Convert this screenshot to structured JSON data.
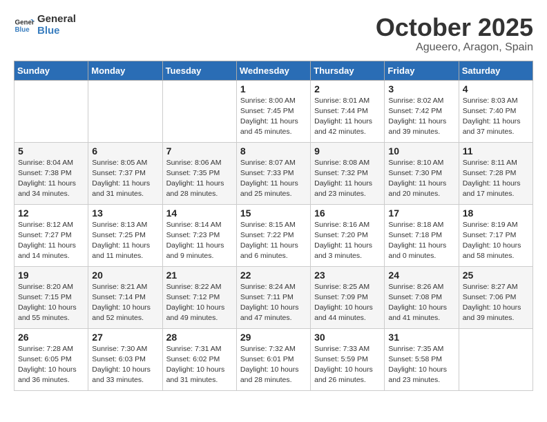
{
  "header": {
    "logo_line1": "General",
    "logo_line2": "Blue",
    "title": "October 2025",
    "subtitle": "Agueero, Aragon, Spain"
  },
  "weekdays": [
    "Sunday",
    "Monday",
    "Tuesday",
    "Wednesday",
    "Thursday",
    "Friday",
    "Saturday"
  ],
  "weeks": [
    [
      {
        "day": "",
        "detail": ""
      },
      {
        "day": "",
        "detail": ""
      },
      {
        "day": "",
        "detail": ""
      },
      {
        "day": "1",
        "detail": "Sunrise: 8:00 AM\nSunset: 7:45 PM\nDaylight: 11 hours\nand 45 minutes."
      },
      {
        "day": "2",
        "detail": "Sunrise: 8:01 AM\nSunset: 7:44 PM\nDaylight: 11 hours\nand 42 minutes."
      },
      {
        "day": "3",
        "detail": "Sunrise: 8:02 AM\nSunset: 7:42 PM\nDaylight: 11 hours\nand 39 minutes."
      },
      {
        "day": "4",
        "detail": "Sunrise: 8:03 AM\nSunset: 7:40 PM\nDaylight: 11 hours\nand 37 minutes."
      }
    ],
    [
      {
        "day": "5",
        "detail": "Sunrise: 8:04 AM\nSunset: 7:38 PM\nDaylight: 11 hours\nand 34 minutes."
      },
      {
        "day": "6",
        "detail": "Sunrise: 8:05 AM\nSunset: 7:37 PM\nDaylight: 11 hours\nand 31 minutes."
      },
      {
        "day": "7",
        "detail": "Sunrise: 8:06 AM\nSunset: 7:35 PM\nDaylight: 11 hours\nand 28 minutes."
      },
      {
        "day": "8",
        "detail": "Sunrise: 8:07 AM\nSunset: 7:33 PM\nDaylight: 11 hours\nand 25 minutes."
      },
      {
        "day": "9",
        "detail": "Sunrise: 8:08 AM\nSunset: 7:32 PM\nDaylight: 11 hours\nand 23 minutes."
      },
      {
        "day": "10",
        "detail": "Sunrise: 8:10 AM\nSunset: 7:30 PM\nDaylight: 11 hours\nand 20 minutes."
      },
      {
        "day": "11",
        "detail": "Sunrise: 8:11 AM\nSunset: 7:28 PM\nDaylight: 11 hours\nand 17 minutes."
      }
    ],
    [
      {
        "day": "12",
        "detail": "Sunrise: 8:12 AM\nSunset: 7:27 PM\nDaylight: 11 hours\nand 14 minutes."
      },
      {
        "day": "13",
        "detail": "Sunrise: 8:13 AM\nSunset: 7:25 PM\nDaylight: 11 hours\nand 11 minutes."
      },
      {
        "day": "14",
        "detail": "Sunrise: 8:14 AM\nSunset: 7:23 PM\nDaylight: 11 hours\nand 9 minutes."
      },
      {
        "day": "15",
        "detail": "Sunrise: 8:15 AM\nSunset: 7:22 PM\nDaylight: 11 hours\nand 6 minutes."
      },
      {
        "day": "16",
        "detail": "Sunrise: 8:16 AM\nSunset: 7:20 PM\nDaylight: 11 hours\nand 3 minutes."
      },
      {
        "day": "17",
        "detail": "Sunrise: 8:18 AM\nSunset: 7:18 PM\nDaylight: 11 hours\nand 0 minutes."
      },
      {
        "day": "18",
        "detail": "Sunrise: 8:19 AM\nSunset: 7:17 PM\nDaylight: 10 hours\nand 58 minutes."
      }
    ],
    [
      {
        "day": "19",
        "detail": "Sunrise: 8:20 AM\nSunset: 7:15 PM\nDaylight: 10 hours\nand 55 minutes."
      },
      {
        "day": "20",
        "detail": "Sunrise: 8:21 AM\nSunset: 7:14 PM\nDaylight: 10 hours\nand 52 minutes."
      },
      {
        "day": "21",
        "detail": "Sunrise: 8:22 AM\nSunset: 7:12 PM\nDaylight: 10 hours\nand 49 minutes."
      },
      {
        "day": "22",
        "detail": "Sunrise: 8:24 AM\nSunset: 7:11 PM\nDaylight: 10 hours\nand 47 minutes."
      },
      {
        "day": "23",
        "detail": "Sunrise: 8:25 AM\nSunset: 7:09 PM\nDaylight: 10 hours\nand 44 minutes."
      },
      {
        "day": "24",
        "detail": "Sunrise: 8:26 AM\nSunset: 7:08 PM\nDaylight: 10 hours\nand 41 minutes."
      },
      {
        "day": "25",
        "detail": "Sunrise: 8:27 AM\nSunset: 7:06 PM\nDaylight: 10 hours\nand 39 minutes."
      }
    ],
    [
      {
        "day": "26",
        "detail": "Sunrise: 7:28 AM\nSunset: 6:05 PM\nDaylight: 10 hours\nand 36 minutes."
      },
      {
        "day": "27",
        "detail": "Sunrise: 7:30 AM\nSunset: 6:03 PM\nDaylight: 10 hours\nand 33 minutes."
      },
      {
        "day": "28",
        "detail": "Sunrise: 7:31 AM\nSunset: 6:02 PM\nDaylight: 10 hours\nand 31 minutes."
      },
      {
        "day": "29",
        "detail": "Sunrise: 7:32 AM\nSunset: 6:01 PM\nDaylight: 10 hours\nand 28 minutes."
      },
      {
        "day": "30",
        "detail": "Sunrise: 7:33 AM\nSunset: 5:59 PM\nDaylight: 10 hours\nand 26 minutes."
      },
      {
        "day": "31",
        "detail": "Sunrise: 7:35 AM\nSunset: 5:58 PM\nDaylight: 10 hours\nand 23 minutes."
      },
      {
        "day": "",
        "detail": ""
      }
    ]
  ]
}
